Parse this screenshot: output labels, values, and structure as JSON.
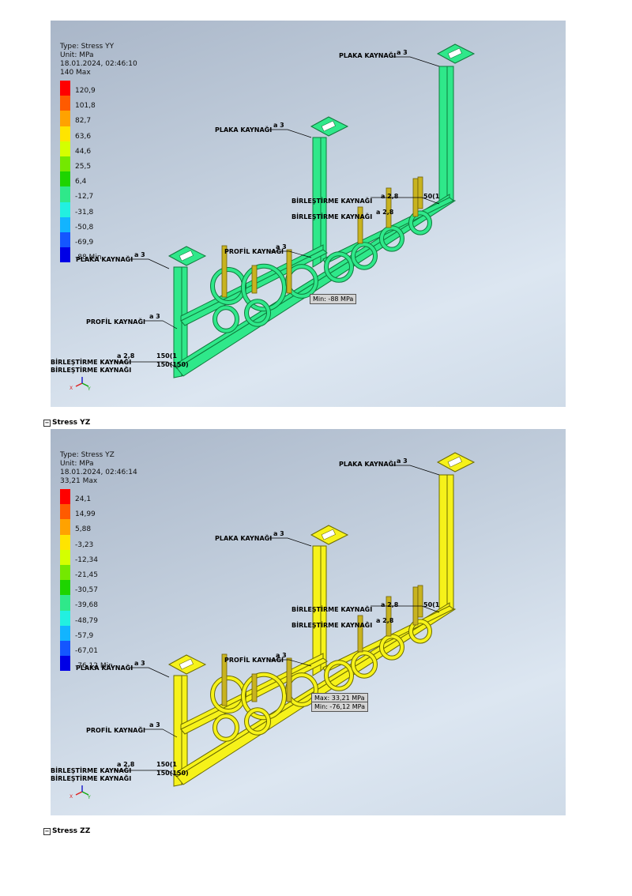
{
  "views": [
    {
      "type_label": "Type: Stress YY",
      "unit_label": "Unit: MPa",
      "timestamp": "18.01.2024, 02:46:10",
      "max_label": "140 Max",
      "min_label": "-88 Min",
      "scale": [
        "120,9",
        "101,8",
        "82,7",
        "63,6",
        "44,6",
        "25,5",
        "6,4",
        "-12,7",
        "-31,8",
        "-50,8",
        "-69,9"
      ],
      "probe_tags": [
        "Min: -88 MPa"
      ],
      "model_color": "#2fe88a",
      "model_edge": "#0f7a3c"
    },
    {
      "type_label": "Type: Stress YZ",
      "unit_label": "Unit: MPa",
      "timestamp": "18.01.2024, 02:46:14",
      "max_label": "33,21 Max",
      "min_label": "-76,12 Min",
      "scale": [
        "24,1",
        "14,99",
        "5,88",
        "-3,23",
        "-12,34",
        "-21,45",
        "-30,57",
        "-39,68",
        "-48,79",
        "-57,9",
        "-67,01"
      ],
      "probe_tags": [
        "Max: 33,21 MPa",
        "Min: -76,12 MPa"
      ],
      "model_color": "#f6f21a",
      "model_edge": "#6b6a00"
    }
  ],
  "legend_colors": [
    "#ff0000",
    "#ff5a00",
    "#ffa200",
    "#ffe400",
    "#d4ff00",
    "#74e800",
    "#1ed400",
    "#2fe88a",
    "#22f0e0",
    "#12b4ff",
    "#1456ff",
    "#0000e6"
  ],
  "weld_labels": {
    "plaka": "PLAKA KAYNAĞI",
    "profil": "PROFİL KAYNAĞI",
    "birlestirme": "BİRLEŞTİRME KAYNAĞI",
    "a3": "a 3",
    "a28": "a 2,8",
    "dim150": "150(1",
    "dim150b": "150(150)",
    "dim50": "50(1"
  },
  "sections": [
    "Stress YZ",
    "Stress ZZ"
  ],
  "section_box_glyph": "−",
  "axis_labels": {
    "x": "X",
    "y": "Y",
    "z": "Z"
  }
}
